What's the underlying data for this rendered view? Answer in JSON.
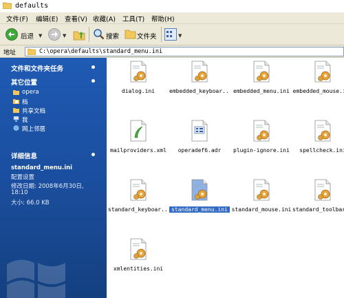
{
  "window": {
    "title": "defaults"
  },
  "menu": [
    "文件(F)",
    "编辑(E)",
    "查看(V)",
    "收藏(A)",
    "工具(T)",
    "帮助(H)"
  ],
  "toolbar": {
    "back_label": "后退",
    "search_label": "搜索",
    "folders_label": "文件夹"
  },
  "address": {
    "label": "地址",
    "value": "C:\\opera\\defaults\\standard_menu.ini"
  },
  "sidebar": {
    "tasks_title": "文件和文件夹任务",
    "places_title": "其它位置",
    "places": [
      "opera",
      "档",
      "共享文档",
      "我",
      "网上邻居"
    ],
    "details_title": "详细信息",
    "detail_name": "standard_menu.ini",
    "detail_type": "配置设置",
    "detail_modified": "修改日期: 2008年6月30日,",
    "detail_time": "18:10",
    "detail_size": "大小: 66.0 KB"
  },
  "files": [
    "dialog.ini",
    "embedded_keyboar...",
    "embedded_menu.ini",
    "embedded_mouse.ini",
    "mailproviders.xml",
    "operadef6.adr",
    "plugin-ignore.ini",
    "spellcheck.ini",
    "standard_keyboar...",
    "standard_menu.ini",
    "standard_mouse.ini",
    "standard_toolbar...",
    "xmlentities.ini"
  ],
  "file_icons": [
    "ini-config-icon",
    "ini-config-icon",
    "ini-config-icon",
    "ini-config-icon",
    "xml-file-icon",
    "adr-file-icon",
    "ini-config-icon",
    "ini-config-icon",
    "ini-config-icon",
    "ini-config-icon",
    "ini-config-icon",
    "ini-config-icon",
    "ini-config-icon"
  ],
  "selected_file": "standard_menu.ini",
  "colors": {
    "sidebar": "#1f5ab4",
    "selection": "#316ac5",
    "chrome": "#ece9d8"
  }
}
